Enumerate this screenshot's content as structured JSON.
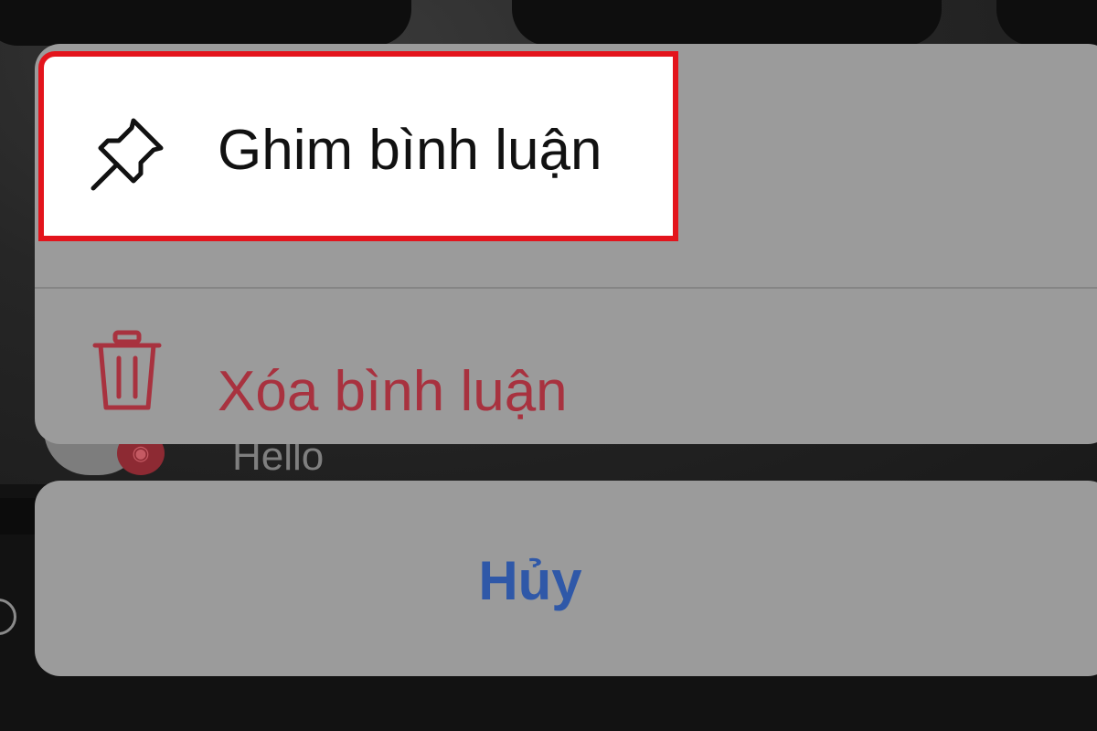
{
  "background": {
    "comment_text": "Hello"
  },
  "action_sheet": {
    "actions": [
      {
        "id": "pin",
        "label": "Ghim bình luận",
        "icon": "pin-icon",
        "color": "#111111",
        "highlighted": true,
        "highlight_color": "#e3141c"
      },
      {
        "id": "delete",
        "label": "Xóa bình luận",
        "icon": "trash-icon",
        "color": "#a8323f",
        "highlighted": false
      }
    ],
    "cancel": {
      "label": "Hủy",
      "color": "#2f58a8"
    }
  }
}
